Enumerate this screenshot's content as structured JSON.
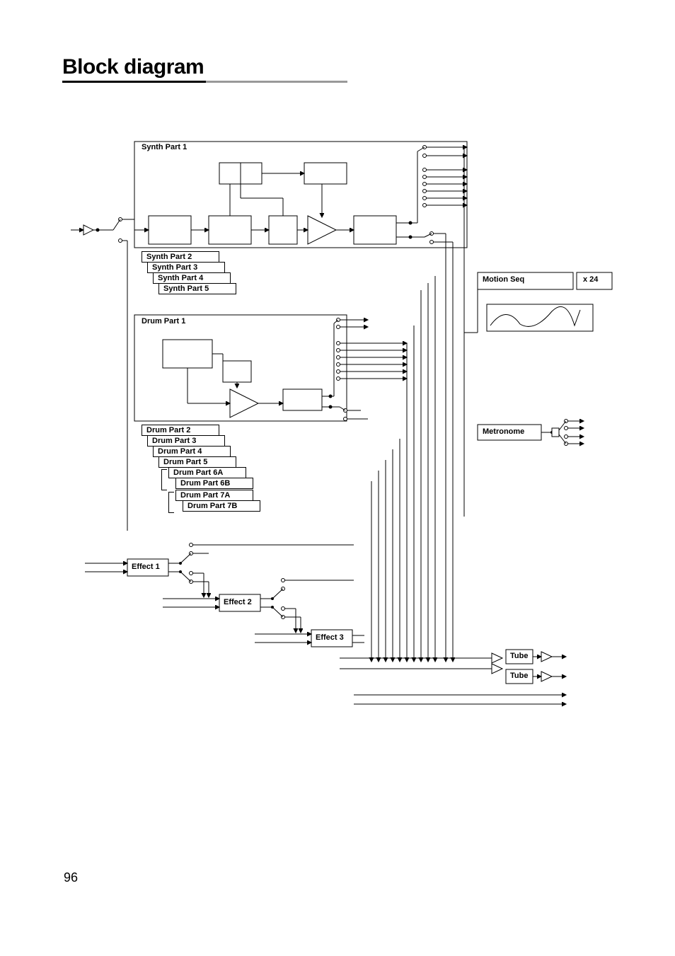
{
  "page": {
    "title": "Block diagram",
    "number": "96"
  },
  "synth": {
    "header": "Synth Part 1",
    "parts": [
      "Synth Part 2",
      "Synth Part 3",
      "Synth Part 4",
      "Synth Part 5"
    ]
  },
  "drum": {
    "header": "Drum Part 1",
    "parts": [
      "Drum Part 2",
      "Drum Part 3",
      "Drum Part 4",
      "Drum Part 5",
      "Drum Part 6A",
      "Drum Part 6B",
      "Drum Part 7A",
      "Drum Part 7B"
    ]
  },
  "effects": {
    "e1": "Effect 1",
    "e2": "Effect 2",
    "e3": "Effect 3"
  },
  "tube": {
    "t1": "Tube",
    "t2": "Tube"
  },
  "side": {
    "motion": "Motion Seq",
    "multiplier": "x 24",
    "metronome": "Metronome"
  }
}
